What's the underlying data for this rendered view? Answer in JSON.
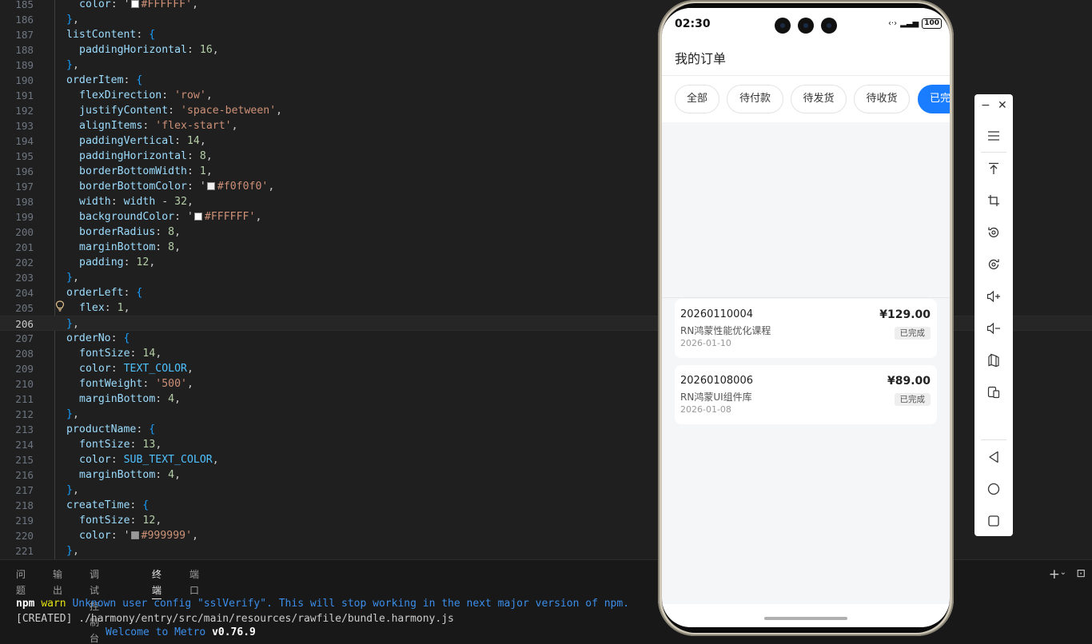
{
  "editor": {
    "lines": [
      {
        "no": "185",
        "html": "<span class=\"i2\"><span class=\"k\">color</span><span class=\"p\">: '</span><span class=\"sw\" style=\"background:#FFFFFF\"></span><span class=\"s\">#FFFFFF'</span><span class=\"p\">,</span></span>"
      },
      {
        "no": "186",
        "html": "<span class=\"b2\">}</span><span class=\"p\">,</span>"
      },
      {
        "no": "187",
        "html": "<span class=\"k\">listContent</span><span class=\"p\">: </span><span class=\"b2\">{</span>"
      },
      {
        "no": "188",
        "html": "<span class=\"i2\"><span class=\"k\">paddingHorizontal</span><span class=\"p\">: </span><span class=\"n\">16</span><span class=\"p\">,</span></span>"
      },
      {
        "no": "189",
        "html": "<span class=\"b2\">}</span><span class=\"p\">,</span>"
      },
      {
        "no": "190",
        "html": "<span class=\"k\">orderItem</span><span class=\"p\">: </span><span class=\"b2\">{</span>"
      },
      {
        "no": "191",
        "html": "<span class=\"i2\"><span class=\"k\">flexDirection</span><span class=\"p\">: </span><span class=\"s\">'row'</span><span class=\"p\">,</span></span>"
      },
      {
        "no": "192",
        "html": "<span class=\"i2\"><span class=\"k\">justifyContent</span><span class=\"p\">: </span><span class=\"s\">'space-between'</span><span class=\"p\">,</span></span>"
      },
      {
        "no": "193",
        "html": "<span class=\"i2\"><span class=\"k\">alignItems</span><span class=\"p\">: </span><span class=\"s\">'flex-start'</span><span class=\"p\">,</span></span>"
      },
      {
        "no": "194",
        "html": "<span class=\"i2\"><span class=\"k\">paddingVertical</span><span class=\"p\">: </span><span class=\"n\">14</span><span class=\"p\">,</span></span>"
      },
      {
        "no": "195",
        "html": "<span class=\"i2\"><span class=\"k\">paddingHorizontal</span><span class=\"p\">: </span><span class=\"n\">8</span><span class=\"p\">,</span></span>"
      },
      {
        "no": "196",
        "html": "<span class=\"i2\"><span class=\"k\">borderBottomWidth</span><span class=\"p\">: </span><span class=\"n\">1</span><span class=\"p\">,</span></span>"
      },
      {
        "no": "197",
        "html": "<span class=\"i2\"><span class=\"k\">borderBottomColor</span><span class=\"p\">: '</span><span class=\"sw\" style=\"background:#f0f0f0\"></span><span class=\"s\">#f0f0f0'</span><span class=\"p\">,</span></span>"
      },
      {
        "no": "198",
        "html": "<span class=\"i2\"><span class=\"k\">width</span><span class=\"p\">: </span><span class=\"k\">width</span><span class=\"p\"> - </span><span class=\"n\">32</span><span class=\"p\">,</span></span>"
      },
      {
        "no": "199",
        "html": "<span class=\"i2\"><span class=\"k\">backgroundColor</span><span class=\"p\">: '</span><span class=\"sw\" style=\"background:#FFFFFF\"></span><span class=\"s\">#FFFFFF'</span><span class=\"p\">,</span></span>"
      },
      {
        "no": "200",
        "html": "<span class=\"i2\"><span class=\"k\">borderRadius</span><span class=\"p\">: </span><span class=\"n\">8</span><span class=\"p\">,</span></span>"
      },
      {
        "no": "201",
        "html": "<span class=\"i2\"><span class=\"k\">marginBottom</span><span class=\"p\">: </span><span class=\"n\">8</span><span class=\"p\">,</span></span>"
      },
      {
        "no": "202",
        "html": "<span class=\"i2\"><span class=\"k\">padding</span><span class=\"p\">: </span><span class=\"n\">12</span><span class=\"p\">,</span></span>"
      },
      {
        "no": "203",
        "html": "<span class=\"b2\">}</span><span class=\"p\">,</span>"
      },
      {
        "no": "204",
        "html": "<span class=\"k\">orderLeft</span><span class=\"p\">: </span><span class=\"b2\">{</span>"
      },
      {
        "no": "205",
        "html": "<span class=\"i2\"><span class=\"k\">flex</span><span class=\"p\">: </span><span class=\"n\">1</span><span class=\"p\">,</span></span>"
      },
      {
        "no": "206",
        "html": "<span class=\"b2\">}</span><span class=\"p\">,</span>"
      },
      {
        "no": "207",
        "html": "<span class=\"k\">orderNo</span><span class=\"p\">: </span><span class=\"b2\">{</span>"
      },
      {
        "no": "208",
        "html": "<span class=\"i2\"><span class=\"k\">fontSize</span><span class=\"p\">: </span><span class=\"n\">14</span><span class=\"p\">,</span></span>"
      },
      {
        "no": "209",
        "html": "<span class=\"i2\"><span class=\"k\">color</span><span class=\"p\">: </span><span class=\"c\">TEXT_COLOR</span><span class=\"p\">,</span></span>"
      },
      {
        "no": "210",
        "html": "<span class=\"i2\"><span class=\"k\">fontWeight</span><span class=\"p\">: </span><span class=\"s\">'500'</span><span class=\"p\">,</span></span>"
      },
      {
        "no": "211",
        "html": "<span class=\"i2\"><span class=\"k\">marginBottom</span><span class=\"p\">: </span><span class=\"n\">4</span><span class=\"p\">,</span></span>"
      },
      {
        "no": "212",
        "html": "<span class=\"b2\">}</span><span class=\"p\">,</span>"
      },
      {
        "no": "213",
        "html": "<span class=\"k\">productName</span><span class=\"p\">: </span><span class=\"b2\">{</span>"
      },
      {
        "no": "214",
        "html": "<span class=\"i2\"><span class=\"k\">fontSize</span><span class=\"p\">: </span><span class=\"n\">13</span><span class=\"p\">,</span></span>"
      },
      {
        "no": "215",
        "html": "<span class=\"i2\"><span class=\"k\">color</span><span class=\"p\">: </span><span class=\"c\">SUB_TEXT_COLOR</span><span class=\"p\">,</span></span>"
      },
      {
        "no": "216",
        "html": "<span class=\"i2\"><span class=\"k\">marginBottom</span><span class=\"p\">: </span><span class=\"n\">4</span><span class=\"p\">,</span></span>"
      },
      {
        "no": "217",
        "html": "<span class=\"b2\">}</span><span class=\"p\">,</span>"
      },
      {
        "no": "218",
        "html": "<span class=\"k\">createTime</span><span class=\"p\">: </span><span class=\"b2\">{</span>"
      },
      {
        "no": "219",
        "html": "<span class=\"i2\"><span class=\"k\">fontSize</span><span class=\"p\">: </span><span class=\"n\">12</span><span class=\"p\">,</span></span>"
      },
      {
        "no": "220",
        "html": "<span class=\"i2\"><span class=\"k\">color</span><span class=\"p\">: '</span><span class=\"sw\" style=\"background:#999999\"></span><span class=\"s\">#999999'</span><span class=\"p\">,</span></span>"
      },
      {
        "no": "221",
        "html": "<span class=\"b2\">}</span><span class=\"p\">,</span>"
      }
    ],
    "current_line": "206"
  },
  "panel": {
    "tabs": [
      "问题",
      "输出",
      "调试控制台",
      "终端",
      "端口"
    ],
    "active_tab": "终端",
    "terminal": {
      "npm": "npm",
      "warn": "warn",
      "warn_msg": "Unknown user config \"sslVerify\". This will stop working in the next major version of npm.",
      "created": "[CREATED] ./harmony/entry/src/main/resources/rawfile/bundle.harmony.js",
      "welcome": "Welcome to Metro",
      "version": "v0.76.9"
    }
  },
  "phone": {
    "time": "02:30",
    "battery": "100",
    "title": "我的订单",
    "filters": [
      {
        "label": "全部",
        "active": false
      },
      {
        "label": "待付款",
        "active": false
      },
      {
        "label": "待发货",
        "active": false
      },
      {
        "label": "待收货",
        "active": false
      },
      {
        "label": "已完",
        "active": true
      }
    ],
    "orders": [
      {
        "order_no": "20260110004",
        "product": "RN鸿蒙性能优化课程",
        "time": "2026-01-10",
        "price": "¥129.00",
        "status": "已完成"
      },
      {
        "order_no": "20260108006",
        "product": "RN鸿蒙UI组件库",
        "time": "2026-01-08",
        "price": "¥89.00",
        "status": "已完成"
      }
    ]
  },
  "toolbar": {
    "icons": [
      "minimize-icon",
      "close-icon",
      "menu-icon",
      "pin-top-icon",
      "crop-icon",
      "rotate-icon",
      "screenshot-icon",
      "volume-up-icon",
      "volume-down-icon",
      "fold-icon",
      "multi-device-icon",
      "back-icon",
      "home-icon",
      "recents-icon"
    ]
  },
  "colors": {
    "accent": "#1a7dff",
    "editor_bg": "#1f1f1f",
    "panel_bg": "#181818"
  }
}
